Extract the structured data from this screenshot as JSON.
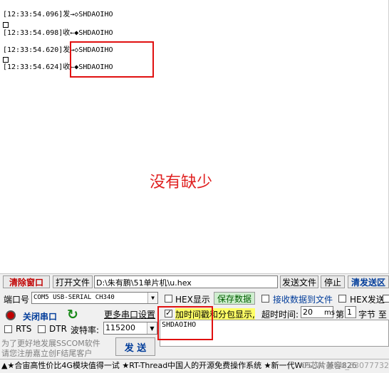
{
  "log": {
    "lines": [
      "[12:33:54.096]发→◇SHDAOIHO",
      "[12:33:54.098]收←◆SHDAOIHO",
      "[12:33:54.620]发→◇SHDAOIHO",
      "[12:33:54.624]收←◆SHDAOIHO"
    ]
  },
  "annotation": {
    "text": "没有缺少",
    "color": "#e02020"
  },
  "toolbar": {
    "clear_window": "清除窗口",
    "open_file": "打开文件",
    "file_path": "D:\\朱有鹏\\51单片机\\u.hex",
    "send_file": "发送文件",
    "stop": "停止",
    "clear_send": "清发送区"
  },
  "port": {
    "port_label": "端口号",
    "port_value": "COM5 USB-SERIAL CH340",
    "close_port": "关闭串口",
    "more_settings": "更多串口设置",
    "rts_label": "RTS",
    "dtr_label": "DTR",
    "baud_label": "波特率:",
    "baud_value": "115200"
  },
  "options": {
    "hex_display": "HEX显示",
    "save_data": "保存数据",
    "recv_to_file": "接收数据到文件",
    "hex_send": "HEX发送",
    "add_timestamp": "加时间戳和分包显示,",
    "timeout_label": "超时时间:",
    "timeout_value": "20",
    "timeout_unit": "ms",
    "byte_label_a": "第",
    "byte_value": "1",
    "byte_label_b": "字节 至"
  },
  "send": {
    "input_value": "SHDAOIHO",
    "send_button": "发 送",
    "promo_line1": "为了更好地发展SSCOM软件",
    "promo_line2": "请您注册嘉立创F结尾客户"
  },
  "footer": {
    "text": "▲★合宙高性价比4G模块值得一试 ★RT-Thread中国人的开源免费操作系统 ★新一代WiFi芯片兼容826",
    "watermark": "CSDN @wd_63077732"
  },
  "colors": {
    "highlight": "#e01010",
    "port_icon": "#c00000",
    "refresh_icon": "#1a8a1a",
    "save_bg": "#cfeecf",
    "timestamp_bg": "#ffff66"
  }
}
